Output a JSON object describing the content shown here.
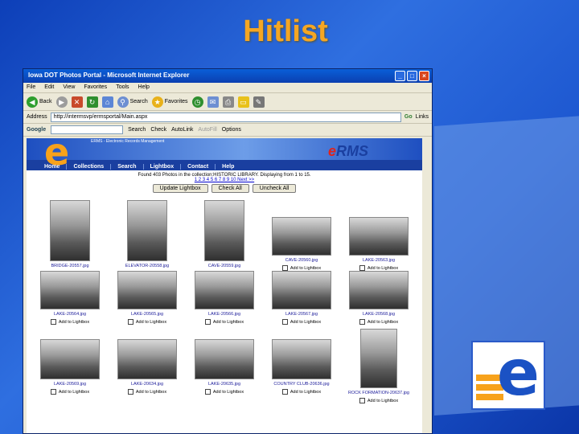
{
  "slide": {
    "title": "Hitlist"
  },
  "window": {
    "title": "Iowa DOT Photos Portal - Microsoft Internet Explorer",
    "controls": [
      "_",
      "□",
      "×"
    ],
    "menu": [
      "File",
      "Edit",
      "View",
      "Favorites",
      "Tools",
      "Help"
    ],
    "toolbar": {
      "back": "Back",
      "search": "Search",
      "favorites": "Favorites"
    },
    "address": {
      "label": "Address",
      "url": "http://intermsvp/ermsportal/Main.aspx",
      "go": "Go",
      "links": "Links"
    },
    "google": {
      "label": "Google",
      "search": "Search",
      "check": "Check",
      "autolink": "AutoLink",
      "autofill": "AutoFill",
      "options": "Options"
    }
  },
  "site": {
    "brand_letter": "e",
    "brand_name_e": "e",
    "brand_name_rest": "RMS",
    "banner_small": "ERMS - Electronic Records Management",
    "nav": [
      "Home",
      "Collections",
      "Search",
      "Lightbox",
      "Contact",
      "Help"
    ],
    "found_text": "Found 403 Photos in the collection:HISTORIC LIBRARY. Displaying from 1 to 15.",
    "pager": "1 2 3 4 5 6 7 8 9 10 Next >>",
    "buttons": {
      "update": "Update Lightbox",
      "check_all": "Check All",
      "uncheck_all": "Uncheck All"
    },
    "add_label": "Add to Lightbox",
    "photos": [
      {
        "name": "BRIDGE-20557.jpg"
      },
      {
        "name": "ELEVATOR-20558.jpg"
      },
      {
        "name": "CAVE-20559.jpg"
      },
      {
        "name": "CAVE-20560.jpg"
      },
      {
        "name": "LAKE-20563.jpg"
      },
      {
        "name": "LAKE-20564.jpg"
      },
      {
        "name": "LAKE-20565.jpg"
      },
      {
        "name": "LAKE-20566.jpg"
      },
      {
        "name": "LAKE-20567.jpg"
      },
      {
        "name": "LAKE-20568.jpg"
      },
      {
        "name": "LAKE-20569.jpg"
      },
      {
        "name": "LAKE-20634.jpg"
      },
      {
        "name": "LAKE-20635.jpg"
      },
      {
        "name": "COUNTRY CLUB-20636.jpg"
      },
      {
        "name": "ROCK FORMATION-20637.jpg"
      }
    ]
  }
}
